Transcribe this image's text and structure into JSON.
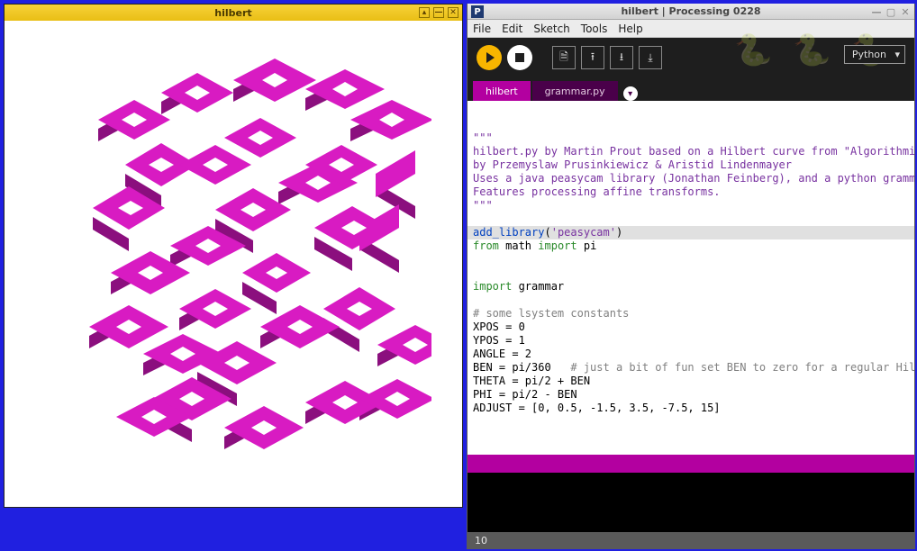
{
  "output_window": {
    "title": "hilbert"
  },
  "ide": {
    "title": "hilbert | Processing 0228",
    "app_badge": "P",
    "menu": {
      "file": "File",
      "edit": "Edit",
      "sketch": "Sketch",
      "tools": "Tools",
      "help": "Help"
    },
    "mode": "Python",
    "tabs": [
      {
        "label": "hilbert",
        "active": true
      },
      {
        "label": "grammar.py",
        "active": false
      }
    ],
    "footer_line": "10",
    "code": {
      "docq": "\"\"\"",
      "d1": "hilbert.py by Martin Prout based on a Hilbert curve from \"Algorithmi",
      "d2": "by Przemyslaw Prusinkiewicz & Aristid Lindenmayer",
      "d3": "Uses a java peasycam library (Jonathan Feinberg), and a python gramm",
      "d4": "Features processing affine transforms.",
      "addlib_fn": "add_library",
      "addlib_arg": "'peasycam'",
      "from": "from",
      "math": " math ",
      "import": "import",
      "pi": " pi",
      "imp_grammar": " grammar",
      "cmt_const": "# some lsystem constants",
      "l_xpos": "XPOS = 0",
      "l_ypos": "YPOS = 1",
      "l_angle": "ANGLE = 2",
      "l_ben": "BEN = pi/360   ",
      "cmt_ben": "# just a bit of fun set BEN to zero for a regular Hil",
      "l_theta": "THETA = pi/2 + BEN",
      "l_phi": "PHI = pi/2 - BEN",
      "l_adjust": "ADJUST = [0, 0.5, -1.5, 3.5, -7.5, 15]"
    }
  }
}
